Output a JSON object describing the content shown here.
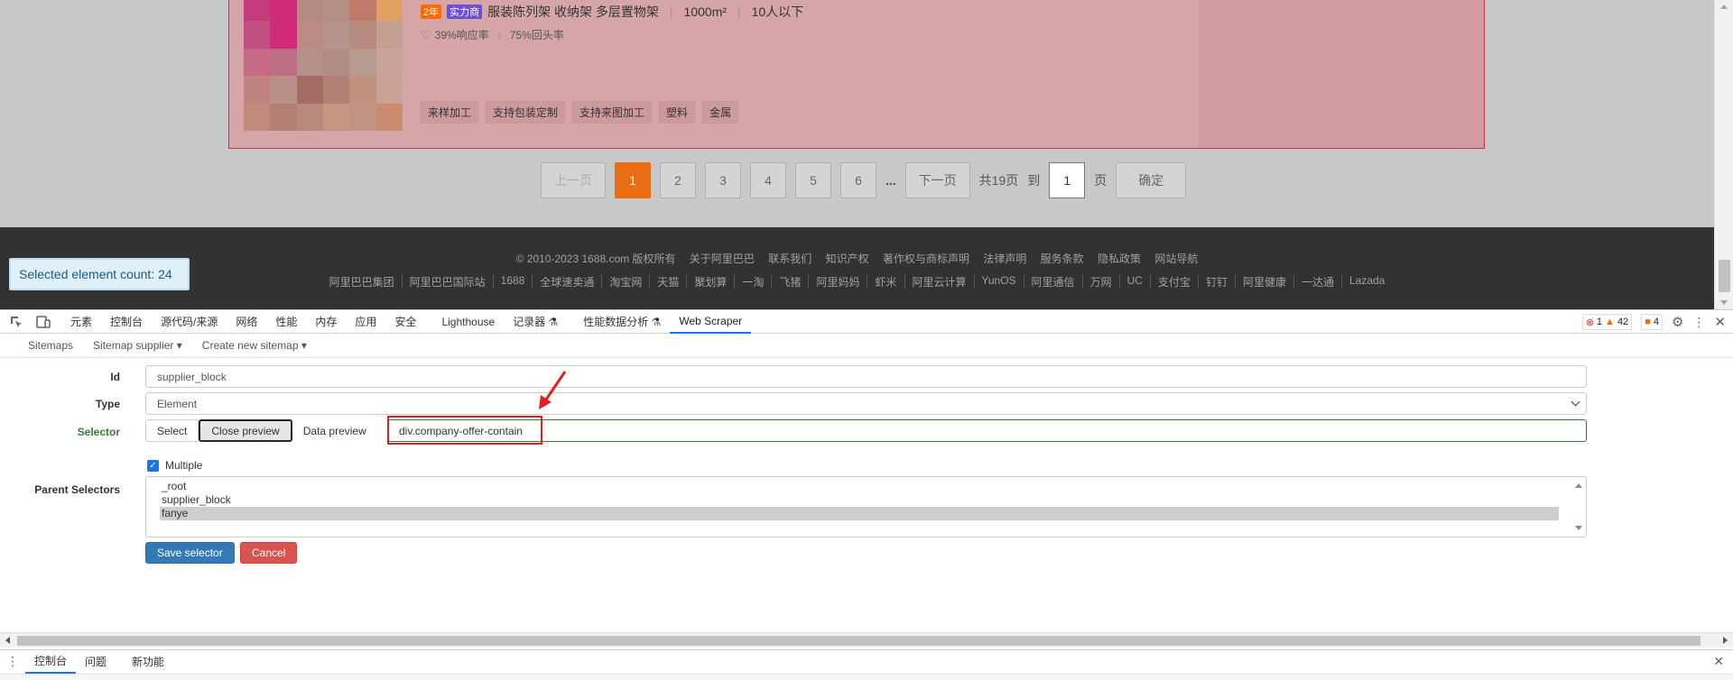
{
  "offer": {
    "badge_year": "2年",
    "badge_trust": "实力商",
    "title": "服装陈列架 收纳架 多层置物架",
    "area": "1000m²",
    "staff": "10人以下",
    "response_rate": "39%响应率",
    "repeat_rate": "75%回头率",
    "tags": [
      "来样加工",
      "支持包装定制",
      "支持来图加工",
      "塑料",
      "金属"
    ]
  },
  "pager": {
    "prev": "上一页",
    "pages": [
      "1",
      "2",
      "3",
      "4",
      "5",
      "6"
    ],
    "ellipsis": "...",
    "next": "下一页",
    "total": "共19页",
    "goto": "到",
    "input_value": "1",
    "page_unit": "页",
    "confirm": "确定"
  },
  "footer": {
    "line1": [
      "© 2010-2023 1688.com 版权所有",
      "关于阿里巴巴",
      "联系我们",
      "知识产权",
      "著作权与商标声明",
      "法律声明",
      "服务条款",
      "隐私政策",
      "网站导航"
    ],
    "line2": [
      "阿里巴巴集团",
      "阿里巴巴国际站",
      "1688",
      "全球速卖通",
      "淘宝网",
      "天猫",
      "聚划算",
      "一淘",
      "飞猪",
      "阿里妈妈",
      "虾米",
      "阿里云计算",
      "YunOS",
      "阿里通信",
      "万网",
      "UC",
      "支付宝",
      "钉钉",
      "阿里健康",
      "一达通",
      "Lazada"
    ]
  },
  "selected_count": "Selected element count: 24",
  "devtools": {
    "tabs": [
      "元素",
      "控制台",
      "源代码/来源",
      "网络",
      "性能",
      "内存",
      "应用",
      "安全",
      "Lighthouse",
      "记录器 ⚗",
      "性能数据分析 ⚗",
      "Web Scraper"
    ],
    "active_tab": "Web Scraper",
    "errors": "1",
    "warnings": "42",
    "info": "4",
    "drawer_tabs": [
      "控制台",
      "问题",
      "新功能"
    ]
  },
  "scraper": {
    "nav": [
      "Sitemaps",
      "Sitemap supplier ▾",
      "Create new sitemap ▾"
    ],
    "id_label": "Id",
    "id_value": "supplier_block",
    "type_label": "Type",
    "type_value": "Element",
    "selector_label": "Selector",
    "btn_select": "Select",
    "btn_close_preview": "Close preview",
    "btn_data_preview": "Data preview",
    "selector_value": "div.company-offer-contain",
    "multiple_label": "Multiple",
    "parent_label": "Parent Selectors",
    "parents": [
      "_root",
      "supplier_block",
      "fanye"
    ],
    "save": "Save selector",
    "cancel": "Cancel"
  },
  "colors": {
    "accent_orange": "#e86d13",
    "highlight_red": "#cc3344",
    "save_blue": "#337ab7",
    "cancel_red": "#d9534f",
    "devtools_blue": "#1a73e8"
  }
}
